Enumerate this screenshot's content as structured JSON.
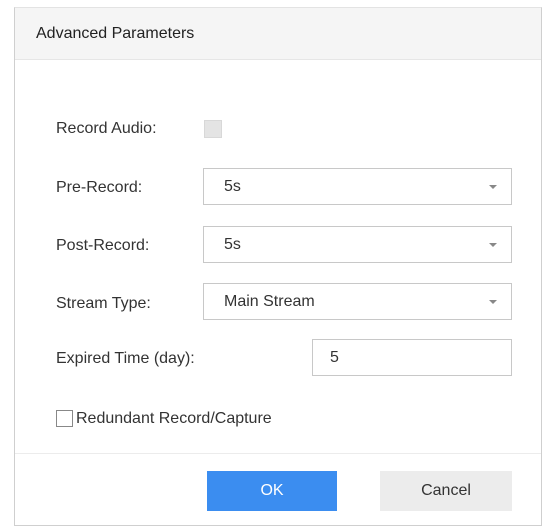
{
  "dialog": {
    "title": "Advanced Parameters"
  },
  "form": {
    "record_audio": {
      "label": "Record Audio:",
      "checked": false,
      "enabled": false
    },
    "pre_record": {
      "label": "Pre-Record:",
      "value": "5s"
    },
    "post_record": {
      "label": "Post-Record:",
      "value": "5s"
    },
    "stream_type": {
      "label": "Stream Type:",
      "value": "Main Stream"
    },
    "expired_time": {
      "label": "Expired Time (day):",
      "value": "5"
    },
    "redundant": {
      "label": "Redundant Record/Capture",
      "checked": false
    }
  },
  "buttons": {
    "ok_label": "OK",
    "cancel_label": "Cancel"
  },
  "colors": {
    "primary": "#3b8df0",
    "secondary_button": "#ececec",
    "header_background": "#f5f5f5"
  },
  "icons": {
    "dropdown": "caret-down-icon"
  }
}
